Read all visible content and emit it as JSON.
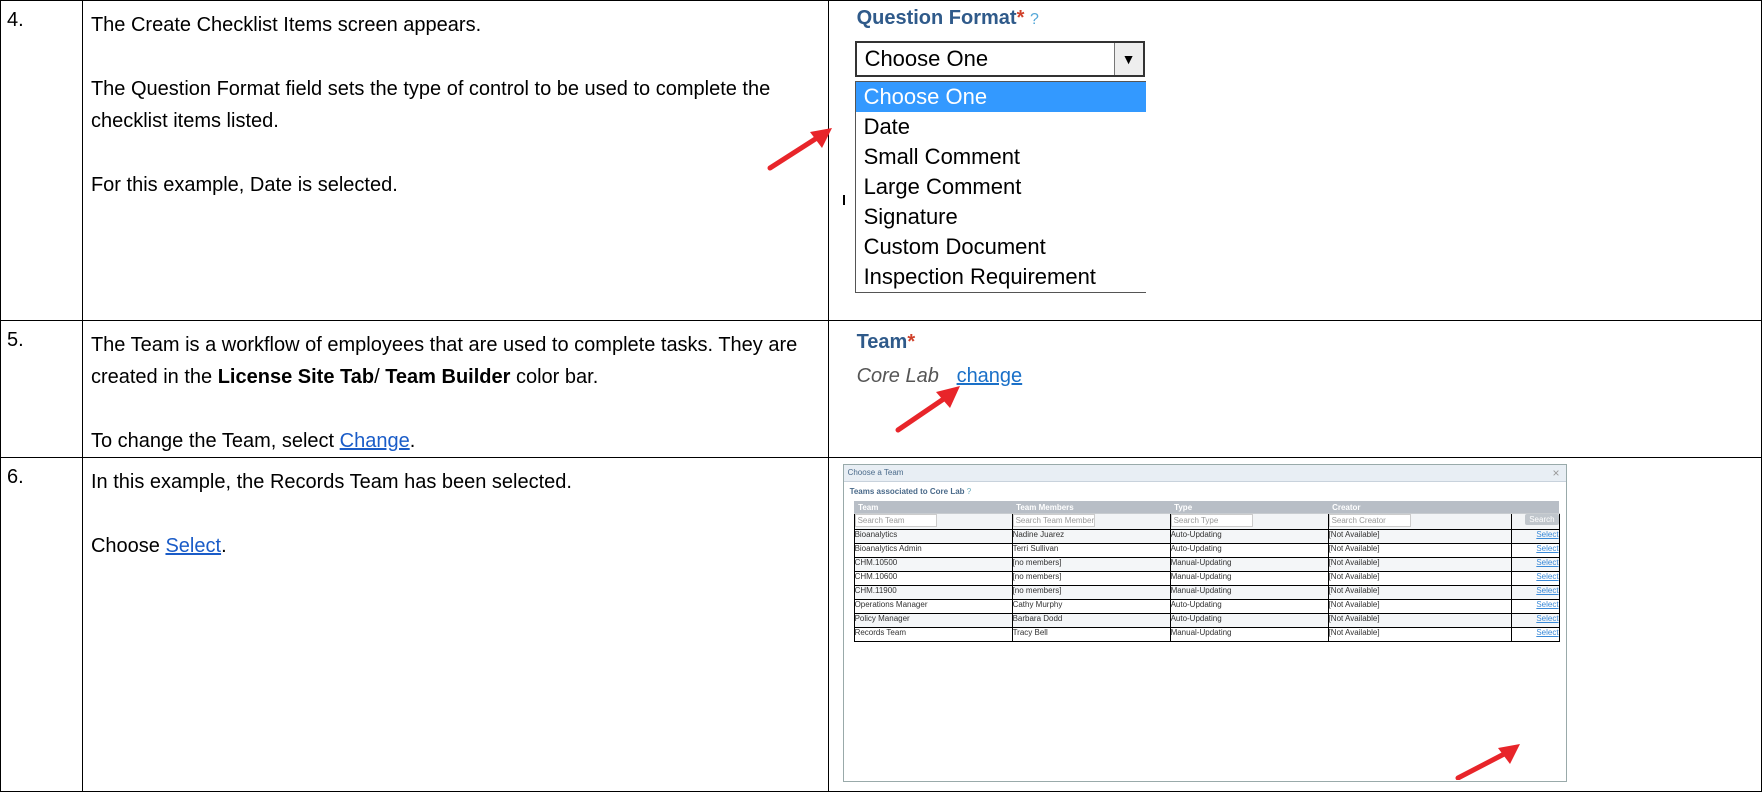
{
  "rows": [
    {
      "num": "4.",
      "paragraphs": [
        "The Create Checklist Items screen appears.",
        "The Question Format field sets the type of control to be used to complete the checklist items listed.",
        "For this example, Date is selected."
      ]
    },
    {
      "num": "5.",
      "p1_a": "The Team is a workflow of employees that are used to complete tasks.  They are created in the ",
      "p1_b1": "License Site Tab",
      "p1_c": "/ ",
      "p1_b2": "Team Builder",
      "p1_d": " color bar.",
      "p2_a": " To change the Team, select ",
      "p2_link": "Change",
      "p2_b": "."
    },
    {
      "num": "6.",
      "p1": "In this example, the Records Team has been selected.",
      "p2_a": "Choose ",
      "p2_link": "Select",
      "p2_b": "."
    }
  ],
  "question_format": {
    "label": "Question Format",
    "required": "*",
    "help": "?",
    "selected": "Choose One",
    "options": [
      "Choose One",
      "Date",
      "Small Comment",
      "Large Comment",
      "Signature",
      "Custom Document",
      "Inspection Requirement"
    ]
  },
  "team": {
    "label": "Team",
    "required": "*",
    "value": "Core Lab",
    "change": "change"
  },
  "dialog": {
    "title": "Choose a Team",
    "close": "×",
    "subtitle": "Teams associated to Core Lab",
    "help": "?",
    "columns": [
      "Team",
      "Team Members",
      "Type",
      "Creator"
    ],
    "placeholders": [
      "Search Team",
      "Search Team Member",
      "Search Type",
      "Search Creator"
    ],
    "search_button": "Search",
    "rows": [
      [
        "Bioanalytics",
        "Nadine Juarez",
        "Auto-Updating",
        "[Not Available]",
        "Select"
      ],
      [
        "Bioanalytics Admin",
        "Terri Sullivan",
        "Auto-Updating",
        "[Not Available]",
        "Select"
      ],
      [
        "CHM.10500",
        "[no members]",
        "Manual-Updating",
        "[Not Available]",
        "Select"
      ],
      [
        "CHM.10600",
        "[no members]",
        "Manual-Updating",
        "[Not Available]",
        "Select"
      ],
      [
        "CHM.11900",
        "[no members]",
        "Manual-Updating",
        "[Not Available]",
        "Select"
      ],
      [
        "Operations Manager",
        "Cathy Murphy",
        "Auto-Updating",
        "[Not Available]",
        "Select"
      ],
      [
        "Policy Manager",
        "Barbara Dodd",
        "Auto-Updating",
        "[Not Available]",
        "Select"
      ],
      [
        "Records Team",
        "Tracy Bell",
        "Manual-Updating",
        "[Not Available]",
        "Select"
      ]
    ]
  },
  "colors": {
    "arrow": "#e8252a",
    "highlight": "#3399ff",
    "link": "#1a5cc8"
  }
}
